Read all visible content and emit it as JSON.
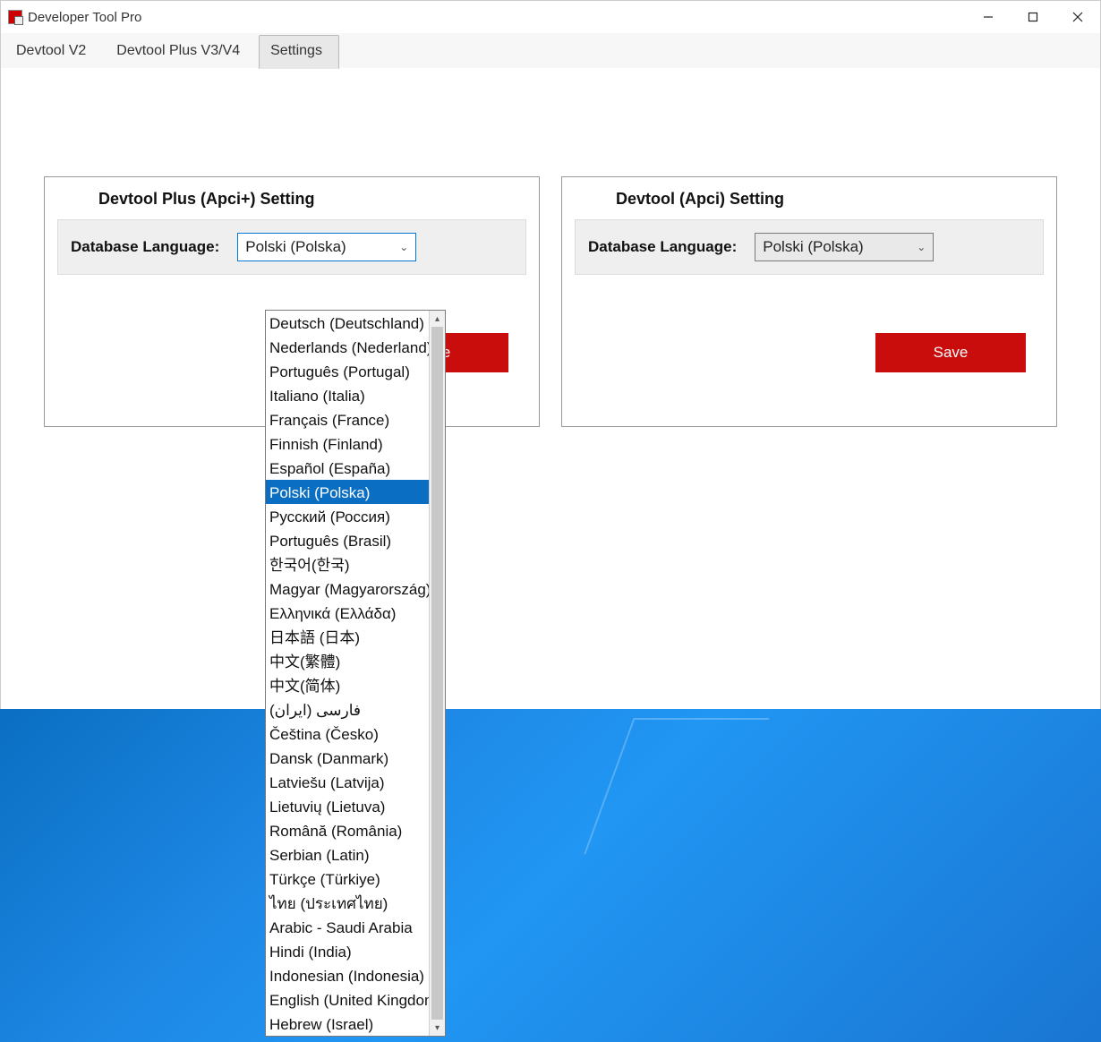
{
  "window": {
    "title": "Developer Tool Pro"
  },
  "tabs": [
    {
      "label": "Devtool V2",
      "active": false
    },
    {
      "label": "Devtool Plus V3/V4",
      "active": false
    },
    {
      "label": "Settings",
      "active": true
    }
  ],
  "panel_left": {
    "title": "Devtool Plus (Apci+) Setting",
    "field_label": "Database Language:",
    "selected": "Polski (Polska)",
    "save_label": "Save"
  },
  "panel_right": {
    "title": "Devtool (Apci) Setting",
    "field_label": "Database Language:",
    "selected": "Polski (Polska)",
    "save_label": "Save"
  },
  "dropdown": {
    "highlighted": "Polski (Polska)",
    "items": [
      "Deutsch (Deutschland)",
      "Nederlands (Nederland)",
      "Português (Portugal)",
      "Italiano (Italia)",
      "Français (France)",
      "Finnish (Finland)",
      "Español (España)",
      "Polski (Polska)",
      "Русский (Россия)",
      "Português (Brasil)",
      "한국어(한국)",
      "Magyar (Magyarország)",
      "Ελληνικά (Ελλάδα)",
      "日本語 (日本)",
      "中文(繁體)",
      "中文(简体)",
      "فارسی (ایران)",
      "Čeština (Česko)",
      "Dansk (Danmark)",
      "Latviešu (Latvija)",
      "Lietuvių (Lietuva)",
      "Română (România)",
      "Serbian (Latin)",
      "Türkçe (Türkiye)",
      "ไทย (ประเทศไทย)",
      "Arabic - Saudi Arabia",
      "Hindi (India)",
      "Indonesian (Indonesia)",
      "English (United Kingdom)",
      "Hebrew (Israel)"
    ]
  }
}
